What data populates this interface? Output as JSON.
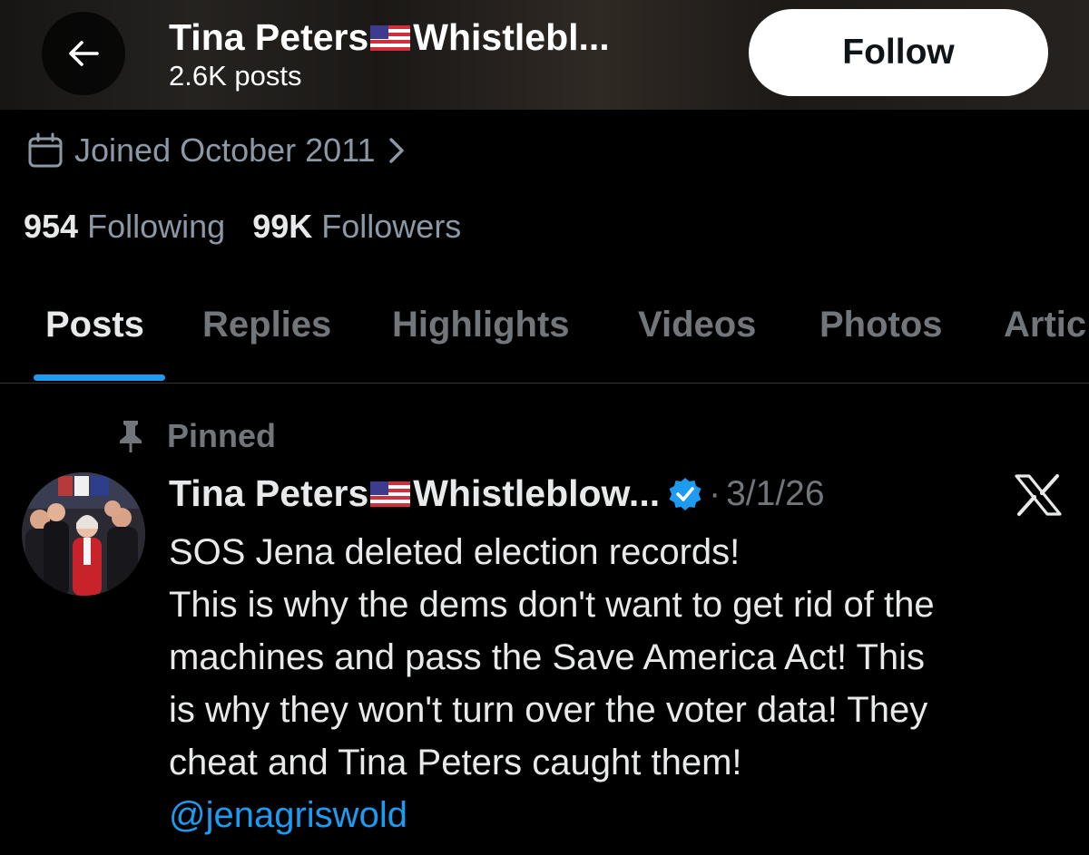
{
  "header": {
    "title": "Tina Peters",
    "title_suffix": "Whistlebl...",
    "posts_count": "2.6K posts",
    "follow_label": "Follow"
  },
  "profile": {
    "joined": "Joined October 2011",
    "following_count": "954",
    "following_label": "Following",
    "followers_count": "99K",
    "followers_label": "Followers"
  },
  "tabs": [
    {
      "label": "Posts",
      "active": true
    },
    {
      "label": "Replies"
    },
    {
      "label": "Highlights"
    },
    {
      "label": "Videos"
    },
    {
      "label": "Photos"
    },
    {
      "label": "Artic"
    }
  ],
  "tweet": {
    "pinned_label": "Pinned",
    "author_name": "Tina Peters",
    "author_suffix": "Whistleblow...",
    "separator": "·",
    "date": "3/1/26",
    "lines": [
      "SOS Jena deleted election records!",
      "This is why the dems don't want to get rid of the",
      "machines and pass the Save America Act! This",
      "is why they won't turn over the voter data! They",
      "cheat and Tina Peters caught them!"
    ],
    "mention": "@jenagriswold"
  },
  "icons": {
    "back": "arrow-left-icon",
    "calendar": "calendar-icon",
    "pin": "pin-icon",
    "verified": "verified-badge-icon",
    "flag": "us-flag-emoji",
    "x_logo": "x-logo-icon"
  },
  "colors": {
    "accent": "#1d9bf0",
    "muted": "#71767b",
    "text": "#e7e9ea",
    "background": "#000000"
  }
}
